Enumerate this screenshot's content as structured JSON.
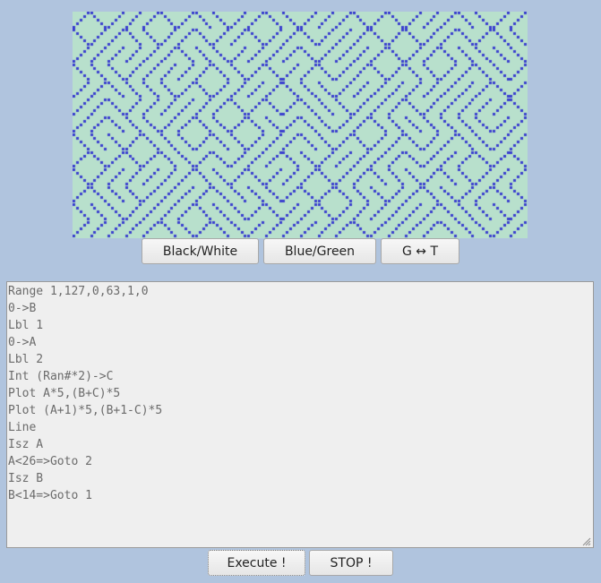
{
  "colors": {
    "background": "#b0c4de",
    "pattern_light": "#b8e0cc",
    "pattern_dark": "#3a3fcf"
  },
  "buttons": {
    "black_white": "Black/White",
    "blue_green": "Blue/Green",
    "g_swap_t": "G ↔ T",
    "execute": "Execute !",
    "stop": "STOP !"
  },
  "editor": {
    "lines": [
      "Range 1,127,0,63,1,0",
      "0->B",
      "Lbl 1",
      "0->A",
      "Lbl 2",
      "Int (Ran#*2)->C",
      "Plot A*5,(B+C)*5",
      "Plot (A+1)*5,(B+1-C)*5",
      "Line",
      "Isz A",
      "A<26=>Goto 2",
      "Isz B",
      "B<14=>Goto 1"
    ]
  }
}
